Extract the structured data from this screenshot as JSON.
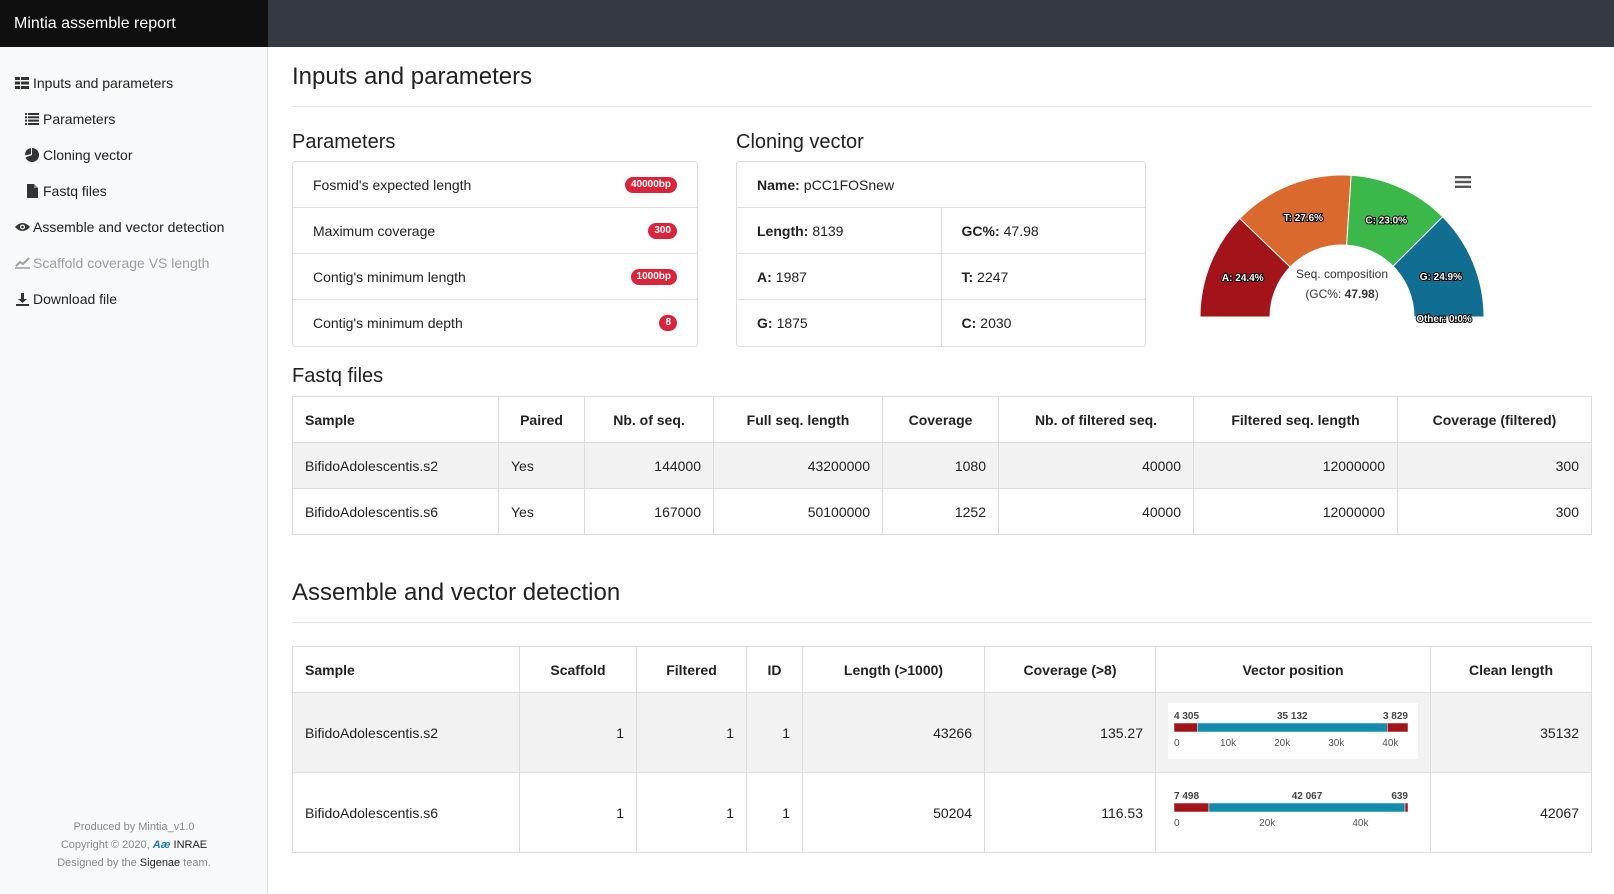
{
  "app": {
    "title": "Mintia assemble report"
  },
  "sidebar": {
    "items": [
      {
        "label": "Inputs and parameters",
        "icon": "list-tree-icon"
      },
      {
        "label": "Parameters",
        "icon": "list-icon"
      },
      {
        "label": "Cloning vector",
        "icon": "pie-chart-icon"
      },
      {
        "label": "Fastq files",
        "icon": "file-icon"
      },
      {
        "label": "Assemble and vector detection",
        "icon": "eye-icon"
      },
      {
        "label": "Scaffold coverage VS length",
        "icon": "line-chart-icon"
      },
      {
        "label": "Download file",
        "icon": "download-icon"
      }
    ],
    "footer": {
      "produced": "Produced by Mintia_v1.0",
      "copyright": "Copyright © 2020,",
      "inrae_logo": "Aæ",
      "inrae": "INRAE",
      "designed_pre": "Designed by the",
      "sigenae": "Sigenae",
      "designed_post": "team."
    }
  },
  "section1": {
    "title": "Inputs and parameters"
  },
  "parameters": {
    "title": "Parameters",
    "rows": [
      {
        "label": "Fosmid's expected length",
        "badge": "40000bp"
      },
      {
        "label": "Maximum coverage",
        "badge": "300"
      },
      {
        "label": "Contig's minimum length",
        "badge": "1000bp"
      },
      {
        "label": "Contig's minimum depth",
        "badge": "8"
      }
    ]
  },
  "cloning": {
    "title": "Cloning vector",
    "name_label": "Name:",
    "name": "pCC1FOSnew",
    "length_label": "Length:",
    "length": "8139",
    "gc_label": "GC%:",
    "gc": "47.98",
    "a_label": "A:",
    "a": "1987",
    "t_label": "T:",
    "t": "2247",
    "g_label": "G:",
    "g": "1875",
    "c_label": "C:",
    "c": "2030"
  },
  "chart_data": {
    "type": "pie",
    "subtype": "semi-circle donut",
    "center_label_1": "Seq. composition",
    "center_label_2_pre": "(GC%:",
    "center_label_2_val": "47.98",
    "center_label_2_post": ")",
    "slices": [
      {
        "name": "A",
        "label": "A: 24.4%",
        "value": 24.4,
        "color": "#a3141a"
      },
      {
        "name": "T",
        "label": "T: 27.6%",
        "value": 27.6,
        "color": "#d9692c"
      },
      {
        "name": "C",
        "label": "C: 23.0%",
        "value": 23.0,
        "color": "#3cb84a"
      },
      {
        "name": "G",
        "label": "G: 24.9%",
        "value": 24.9,
        "color": "#0f6e91"
      },
      {
        "name": "Other",
        "label": "Other: 0.0%",
        "value": 0.0,
        "color": "#888888"
      }
    ]
  },
  "fastq": {
    "title": "Fastq files",
    "headers": [
      "Sample",
      "Paired",
      "Nb. of seq.",
      "Full seq. length",
      "Coverage",
      "Nb. of filtered seq.",
      "Filtered seq. length",
      "Coverage (filtered)"
    ],
    "rows": [
      [
        "BifidoAdolescentis.s2",
        "Yes",
        "144000",
        "43200000",
        "1080",
        "40000",
        "12000000",
        "300"
      ],
      [
        "BifidoAdolescentis.s6",
        "Yes",
        "167000",
        "50100000",
        "1252",
        "40000",
        "12000000",
        "300"
      ]
    ]
  },
  "assemble": {
    "title": "Assemble and vector detection",
    "headers": [
      "Sample",
      "Scaffold",
      "Filtered",
      "ID",
      "Length (>1000)",
      "Coverage (>8)",
      "Vector position",
      "Clean length"
    ],
    "rows": [
      {
        "cells": [
          "BifidoAdolescentis.s2",
          "1",
          "1",
          "1",
          "43266",
          "135.27"
        ],
        "clean": "35132",
        "vector": {
          "total": 43266,
          "segments": [
            {
              "len": 4305,
              "label": "4 305",
              "color": "#a3141a"
            },
            {
              "len": 35132,
              "label": "35 132",
              "color": "#138bad"
            },
            {
              "len": 3829,
              "label": "3 829",
              "color": "#a3141a"
            }
          ],
          "axis_max": 43266,
          "ticks": [
            {
              "value": 0,
              "label": "0"
            },
            {
              "value": 10000,
              "label": "10k"
            },
            {
              "value": 20000,
              "label": "20k"
            },
            {
              "value": 30000,
              "label": "30k"
            },
            {
              "value": 40000,
              "label": "40k"
            }
          ]
        }
      },
      {
        "cells": [
          "BifidoAdolescentis.s6",
          "1",
          "1",
          "1",
          "50204",
          "116.53"
        ],
        "clean": "42067",
        "vector": {
          "total": 50204,
          "segments": [
            {
              "len": 7498,
              "label": "7 498",
              "color": "#a3141a"
            },
            {
              "len": 42067,
              "label": "42 067",
              "color": "#138bad"
            },
            {
              "len": 639,
              "label": "639",
              "color": "#a3141a"
            }
          ],
          "axis_max": 50204,
          "ticks": [
            {
              "value": 0,
              "label": "0"
            },
            {
              "value": 20000,
              "label": "20k"
            },
            {
              "value": 40000,
              "label": "40k"
            }
          ]
        }
      }
    ]
  }
}
